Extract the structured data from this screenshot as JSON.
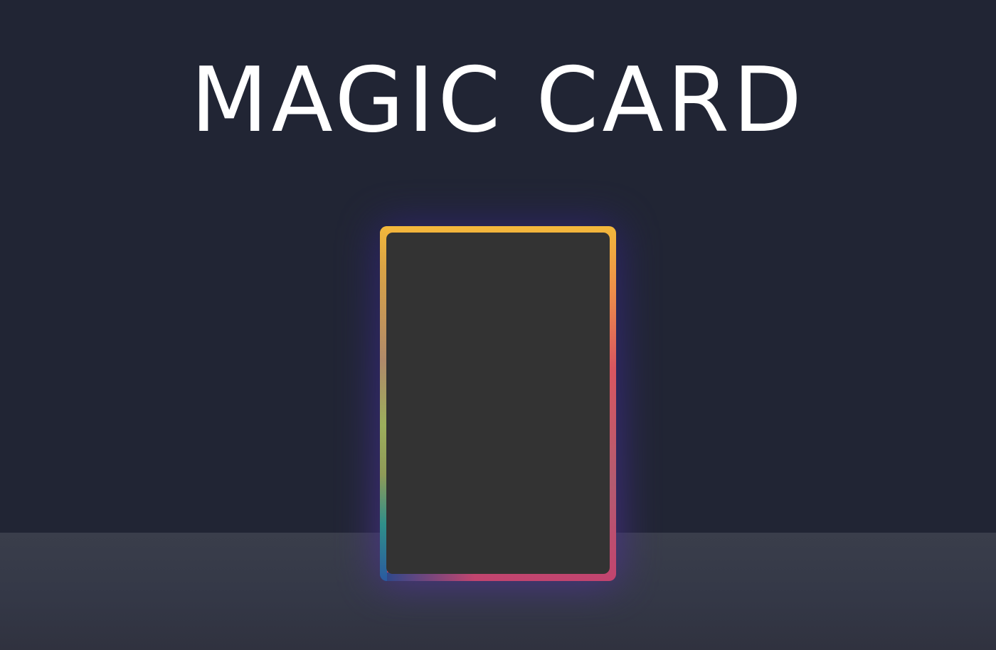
{
  "page": {
    "title": "MAGIC CARD"
  },
  "colors": {
    "background": "#212534",
    "floor": "#383c4a",
    "card_face": "#333333",
    "border_gradient": [
      "#f3b83b",
      "#ee8f4a",
      "#d95660",
      "#c2446f",
      "#9cae5c",
      "#2a5aa0"
    ],
    "glow": "#3a2a8a"
  },
  "card": {
    "state": "face-down"
  }
}
